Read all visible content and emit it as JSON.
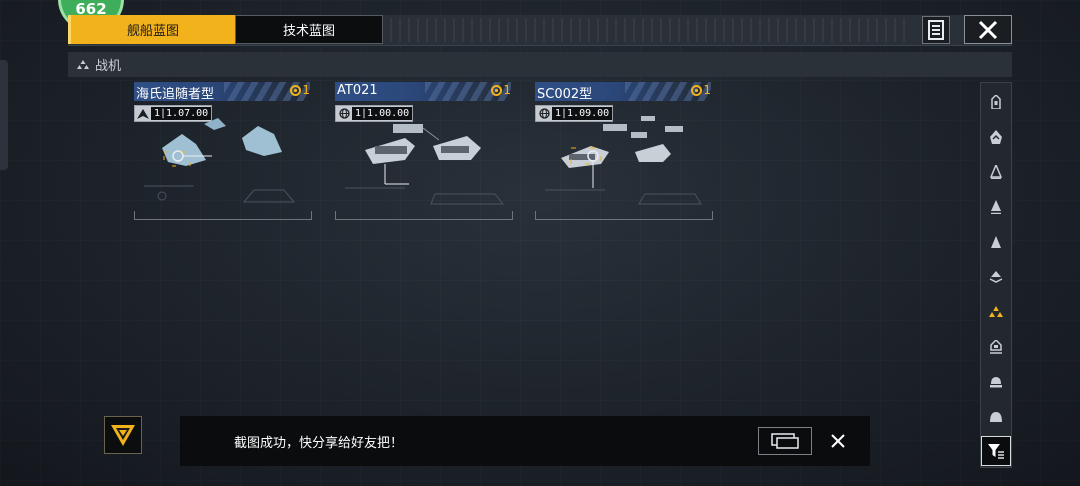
{
  "logo": {
    "text": "662"
  },
  "tabs": [
    {
      "label": "舰船蓝图",
      "active": true
    },
    {
      "label": "技术蓝图",
      "active": false
    }
  ],
  "top_right": {
    "doc_icon": "document-list-icon",
    "close_icon": "close-icon"
  },
  "category": {
    "label": "战机",
    "icon": "fighter-icon"
  },
  "ships": [
    {
      "name": "海氏追随者型",
      "cost": "1",
      "stat_icon": "fighter-wing-icon",
      "stat_value": "1|1.07.00",
      "accent": "#f2b21b"
    },
    {
      "name": "AT021",
      "cost": "1",
      "stat_icon": "globe-icon",
      "stat_value": "1|1.00.00",
      "accent": "#f2b21b"
    },
    {
      "name": "SC002型",
      "cost": "1",
      "stat_icon": "globe-icon",
      "stat_value": "1|1.09.00",
      "accent": "#f2b21b"
    }
  ],
  "filters": [
    {
      "icon": "battleship-icon",
      "active": false
    },
    {
      "icon": "carrier-icon",
      "active": false
    },
    {
      "icon": "cruiser-icon",
      "active": false
    },
    {
      "icon": "destroyer-icon",
      "active": false
    },
    {
      "icon": "frigate-icon",
      "active": false
    },
    {
      "icon": "corvette-icon",
      "active": false
    },
    {
      "icon": "fighter-icon",
      "active": true
    },
    {
      "icon": "support-icon",
      "active": false
    },
    {
      "icon": "station-icon",
      "active": false
    },
    {
      "icon": "dome-icon",
      "active": false
    }
  ],
  "filter_funnel": {
    "icon": "filter-funnel-icon"
  },
  "toast": {
    "icon": "rank-chevron-icon",
    "message": "截图成功，快分享给好友把！",
    "share_icon": "share-screenshot-icon",
    "close_icon": "close-icon"
  },
  "colors": {
    "accent": "#f2b21b",
    "card_header": "#2f4f86",
    "background": "#1f252d"
  }
}
